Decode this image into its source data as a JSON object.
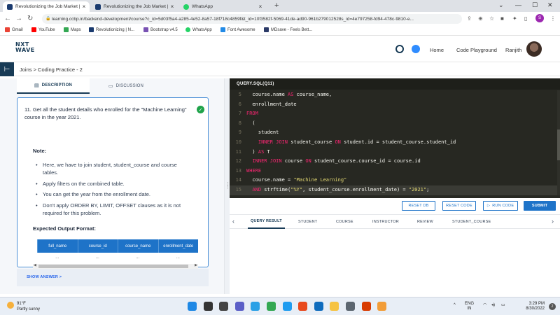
{
  "browser": {
    "tabs": [
      {
        "title": "Revolutionizing the Job Market | NxtWave",
        "active": true,
        "favicon_color": "#1a3a6e"
      },
      {
        "title": "Revolutionizing the Job Market | NxtWave",
        "active": false,
        "favicon_color": "#1a3a6e"
      },
      {
        "title": "WhatsApp",
        "active": false,
        "favicon_color": "#25d366"
      }
    ],
    "new_tab": "+",
    "url": "learning.ccbp.in/backend-development/course?c_id=5d03f5a4-a285-4e52-8a57-18f718c4859f&t_id=10f3582f-5069-41de-ad90-961b279012528s_id=4e797258-fd94-478c-9810-e...",
    "profile_initial": "S",
    "bookmarks": [
      {
        "label": "Gmail",
        "icon": "gmail-icon",
        "color": "#ea4335"
      },
      {
        "label": "YouTube",
        "icon": "youtube-icon",
        "color": "#ff0000"
      },
      {
        "label": "Maps",
        "icon": "maps-icon",
        "color": "#34a853"
      },
      {
        "label": "Revolutionizing | N...",
        "icon": "nxtwave-icon",
        "color": "#1a3a6e"
      },
      {
        "label": "Bootstrap v4.5",
        "icon": "bootstrap-icon",
        "color": "#7952b3"
      },
      {
        "label": "WhatsApp",
        "icon": "whatsapp-icon",
        "color": "#25d366"
      },
      {
        "label": "Font Awesome",
        "icon": "fontawesome-icon",
        "color": "#228ae6"
      },
      {
        "label": "MDsave - Feels Bett...",
        "icon": "mdsave-icon",
        "color": "#2b3a67"
      }
    ]
  },
  "app": {
    "logo_line1": "NXT",
    "logo_line2": "WAVE",
    "nav": {
      "home": "Home",
      "code_playground": "Code Playground",
      "user": "Ranjith"
    }
  },
  "breadcrumb": "Joins > Coding Practice - 2",
  "left": {
    "tabs": [
      {
        "label": "DESCRIPTION",
        "icon": "document-icon",
        "active": true
      },
      {
        "label": "DISCUSSION",
        "icon": "chat-icon",
        "active": false
      }
    ],
    "question": "11.  Get all the student details who enrolled for the \"Machine Learning\" course in the year 2021.",
    "note_heading": "Note:",
    "notes": [
      "Here, we have to join student, student_course and course tables.",
      "Apply filters on the combined table.",
      "You can get the year from the enrollment date.",
      "Don't apply ORDER BY, LIMIT, OFFSET clauses as it is not required for this problem."
    ],
    "expected_heading": "Expected Output Format:",
    "output_columns": [
      "full_name",
      "course_id",
      "course_name",
      "enrollment_date"
    ],
    "output_row": [
      "...",
      "...",
      "...",
      "..."
    ],
    "show_answer": "SHOW ANSWER >"
  },
  "editor": {
    "file_tab": "QUERY.SQL(Q11)",
    "lines": [
      {
        "n": "5",
        "html": "  course.name <span class='kw'>AS</span> course_name,"
      },
      {
        "n": "6",
        "html": "  enrollment_date"
      },
      {
        "n": "7",
        "html": "<span class='kw'>FROM</span>"
      },
      {
        "n": "8",
        "html": "  ("
      },
      {
        "n": "9",
        "html": "    student"
      },
      {
        "n": "10",
        "html": "    <span class='kw'>INNER JOIN</span> student_course <span class='kw'>ON</span> student.id = student_course.student_id"
      },
      {
        "n": "11",
        "html": "  ) <span class='kw'>AS</span> T"
      },
      {
        "n": "12",
        "html": "  <span class='kw'>INNER JOIN</span> course <span class='kw'>ON</span> student_course.course_id = course.id"
      },
      {
        "n": "13",
        "html": "<span class='kw'>WHERE</span>"
      },
      {
        "n": "14",
        "html": "  course.name = <span class='str'>\"Machine Learning\"</span>"
      },
      {
        "n": "15",
        "html": "  <span class='kw'>AND</span> strftime(<span class='str'>\"%Y\"</span>, student_course.enrollment_date) = <span class='str'>\"2021\"</span>;",
        "highlight": true
      }
    ]
  },
  "actions": {
    "reset_db": "RESET DB",
    "reset_code": "RESET CODE",
    "run_code": "RUN CODE",
    "submit": "SUBMIT"
  },
  "results": {
    "tabs": [
      "QUERY RESULT",
      "STUDENT",
      "COURSE",
      "INSTRUCTOR",
      "REVIEW",
      "STUDENT_COURSE"
    ],
    "active_tab": "QUERY RESULT"
  },
  "taskbar": {
    "temperature": "91°F",
    "weather": "Partly sunny",
    "lang_line1": "ENG",
    "lang_line2": "IN",
    "time": "3:29 PM",
    "date": "8/30/2022",
    "notification_count": "2",
    "apps": [
      {
        "name": "windows-start-icon",
        "color": "#1e88e5"
      },
      {
        "name": "search-icon",
        "color": "#333333"
      },
      {
        "name": "task-view-icon",
        "color": "#444444"
      },
      {
        "name": "teams-icon",
        "color": "#5b5fc7"
      },
      {
        "name": "edge-icon",
        "color": "#2aa0e6"
      },
      {
        "name": "chrome-icon",
        "color": "#34a853"
      },
      {
        "name": "vscode-icon",
        "color": "#1f9cf0"
      },
      {
        "name": "office-icon",
        "color": "#e8491d"
      },
      {
        "name": "mail-icon",
        "color": "#0f6cbd"
      },
      {
        "name": "file-explorer-icon",
        "color": "#f6c342"
      },
      {
        "name": "settings-icon",
        "color": "#5c6670"
      },
      {
        "name": "office-alt-icon",
        "color": "#d83b01"
      },
      {
        "name": "paint-icon",
        "color": "#f29d38"
      }
    ]
  }
}
